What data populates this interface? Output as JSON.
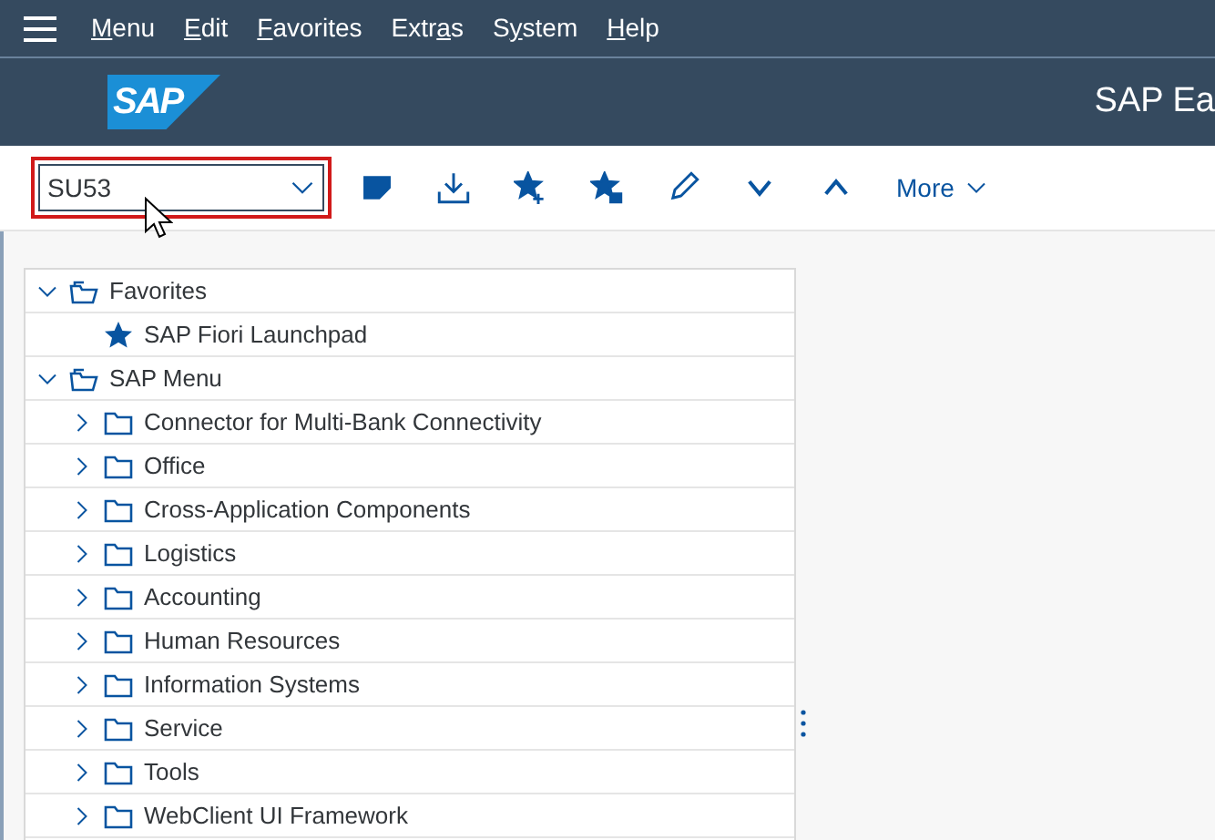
{
  "menu_bar": [
    {
      "access_key": "M",
      "after": "enu"
    },
    {
      "access_key": "E",
      "after": "dit"
    },
    {
      "access_key": "F",
      "after": "avorites"
    },
    {
      "before": "Extr",
      "access_key": "a",
      "after": "s"
    },
    {
      "before": "S",
      "access_key": "y",
      "after": "stem"
    },
    {
      "access_key": "H",
      "after": "elp"
    }
  ],
  "header": {
    "logo_text": "SAP",
    "title": "SAP Ea"
  },
  "toolbar": {
    "command_field": {
      "value": "SU53",
      "highlighted": true
    },
    "more_label": "More"
  },
  "tree": [
    {
      "label": "Favorites",
      "kind": "root",
      "expanded": true,
      "children": [
        {
          "label": "SAP Fiori Launchpad",
          "kind": "favorite"
        }
      ]
    },
    {
      "label": "SAP Menu",
      "kind": "root",
      "expanded": true,
      "children": [
        {
          "label": "Connector for Multi-Bank Connectivity",
          "kind": "folder",
          "expanded": false
        },
        {
          "label": "Office",
          "kind": "folder",
          "expanded": false
        },
        {
          "label": "Cross-Application Components",
          "kind": "folder",
          "expanded": false
        },
        {
          "label": "Logistics",
          "kind": "folder",
          "expanded": false
        },
        {
          "label": "Accounting",
          "kind": "folder",
          "expanded": false
        },
        {
          "label": "Human Resources",
          "kind": "folder",
          "expanded": false
        },
        {
          "label": "Information Systems",
          "kind": "folder",
          "expanded": false
        },
        {
          "label": "Service",
          "kind": "folder",
          "expanded": false
        },
        {
          "label": "Tools",
          "kind": "folder",
          "expanded": false
        },
        {
          "label": "WebClient UI Framework",
          "kind": "folder",
          "expanded": false
        }
      ]
    }
  ]
}
